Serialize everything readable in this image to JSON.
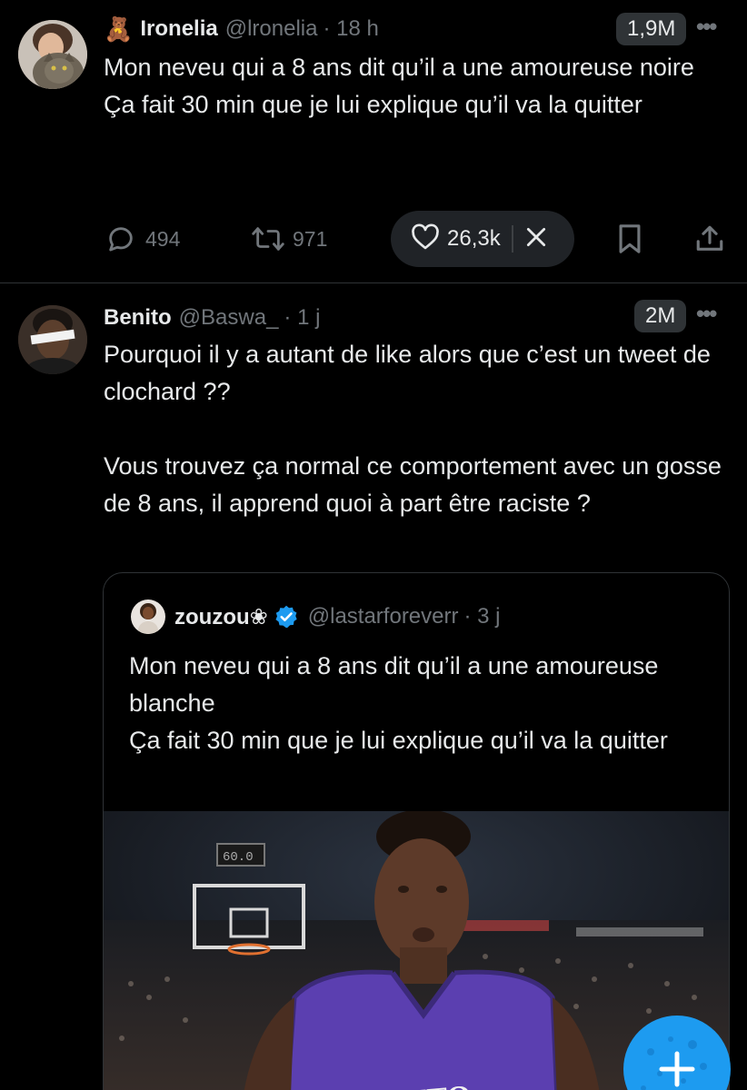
{
  "tweet1": {
    "emoji": "🧸",
    "name": "Ironelia",
    "handle": "@lronelia",
    "time": "· 18 h",
    "views": "1,9M",
    "text": "Mon neveu qui a 8 ans dit qu’il a une amoureuse noire\nÇa fait 30 min que je lui explique qu’il va la quitter",
    "replies": "494",
    "retweets": "971",
    "likes": "26,3k"
  },
  "tweet2": {
    "name": "Benito",
    "handle": "@Baswa_",
    "time": "· 1 j",
    "views": "2M",
    "text": "Pourquoi il y a autant de like alors que c’est un tweet de clochard ??\n\nVous trouvez ça normal ce comportement avec un gosse de 8 ans, il apprend quoi à part être raciste ?"
  },
  "quoted": {
    "name": "zouzou❀",
    "handle": "@lastarforeverr",
    "time": "· 3 j",
    "text": "Mon neveu qui a 8 ans dit qu’il a une amoureuse blanche\nÇa fait 30 min que je lui explique qu’il va la quitter",
    "scoreboard": "60.0",
    "jersey": "TORONTO"
  },
  "icons": {
    "more": "more-icon",
    "reply": "reply-icon",
    "retweet": "retweet-icon",
    "like": "heart-icon",
    "close": "close-icon",
    "bookmark": "bookmark-icon",
    "share": "share-icon",
    "verified": "verified-badge-icon",
    "compose": "plus-icon"
  },
  "colors": {
    "background": "#000000",
    "text": "#e7e9ea",
    "muted": "#71767b",
    "accent": "#1d9bf0",
    "jersey": "#5b3fb0"
  }
}
